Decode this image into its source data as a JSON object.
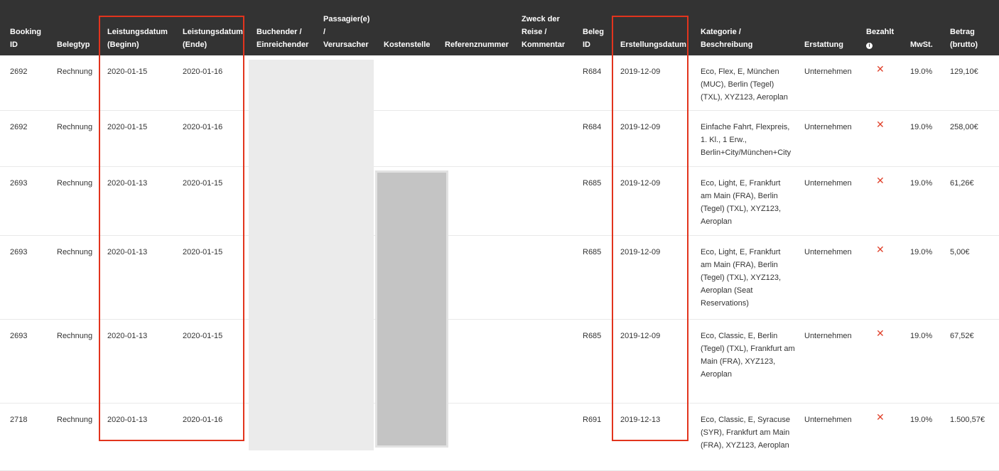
{
  "columns": [
    {
      "key": "booking_id",
      "label": "Booking\nID"
    },
    {
      "key": "belegtyp",
      "label": "Belegtyp"
    },
    {
      "key": "leist_beginn",
      "label": "Leistungsdatum\n(Beginn)"
    },
    {
      "key": "leist_ende",
      "label": "Leistungsdatum\n(Ende)"
    },
    {
      "key": "buchender",
      "label": "Buchender /\nEinreichender"
    },
    {
      "key": "passagier",
      "label": "Passagier(e)\n/\nVerursacher"
    },
    {
      "key": "kostenstelle",
      "label": "Kostenstelle"
    },
    {
      "key": "referenz",
      "label": "Referenznummer"
    },
    {
      "key": "zweck",
      "label": "Zweck der\nReise /\nKommentar"
    },
    {
      "key": "beleg_id",
      "label": "Beleg\nID"
    },
    {
      "key": "erstellung",
      "label": "Erstellungsdatum"
    },
    {
      "key": "kategorie",
      "label": "Kategorie /\nBeschreibung"
    },
    {
      "key": "erstattung",
      "label": "Erstattung"
    },
    {
      "key": "bezahlt",
      "label": "Bezahlt",
      "icon": "info-circle-icon"
    },
    {
      "key": "mwst",
      "label": "MwSt."
    },
    {
      "key": "betrag",
      "label": "Betrag\n(brutto)"
    }
  ],
  "rows": [
    {
      "booking_id": "2692",
      "belegtyp": "Rechnung",
      "leist_beginn": "2020-01-15",
      "leist_ende": "2020-01-16",
      "beleg_id": "R684",
      "erstellung": "2019-12-09",
      "kategorie": "Eco, Flex, E, München\n(MUC), Berlin (Tegel)\n(TXL), XYZ123, Aeroplan",
      "erstattung": "Unternehmen",
      "bezahlt": "✕",
      "mwst": "19.0%",
      "betrag": "129,10€"
    },
    {
      "booking_id": "2692",
      "belegtyp": "Rechnung",
      "leist_beginn": "2020-01-15",
      "leist_ende": "2020-01-16",
      "beleg_id": "R684",
      "erstellung": "2019-12-09",
      "kategorie": "Einfache Fahrt, Flexpreis,\n1. Kl., 1 Erw.,\nBerlin+City/München+City",
      "erstattung": "Unternehmen",
      "bezahlt": "✕",
      "mwst": "19.0%",
      "betrag": "258,00€"
    },
    {
      "booking_id": "2693",
      "belegtyp": "Rechnung",
      "leist_beginn": "2020-01-13",
      "leist_ende": "2020-01-15",
      "beleg_id": "R685",
      "erstellung": "2019-12-09",
      "kategorie": "Eco, Light, E, Frankfurt\nam Main (FRA), Berlin\n(Tegel) (TXL), XYZ123,\nAeroplan",
      "erstattung": "Unternehmen",
      "bezahlt": "✕",
      "mwst": "19.0%",
      "betrag": "61,26€"
    },
    {
      "booking_id": "2693",
      "belegtyp": "Rechnung",
      "leist_beginn": "2020-01-13",
      "leist_ende": "2020-01-15",
      "beleg_id": "R685",
      "erstellung": "2019-12-09",
      "kategorie": "Eco, Light, E, Frankfurt\nam Main (FRA), Berlin\n(Tegel) (TXL), XYZ123,\nAeroplan (Seat\nReservations)",
      "erstattung": "Unternehmen",
      "bezahlt": "✕",
      "mwst": "19.0%",
      "betrag": "5,00€"
    },
    {
      "booking_id": "2693",
      "belegtyp": "Rechnung",
      "leist_beginn": "2020-01-13",
      "leist_ende": "2020-01-15",
      "beleg_id": "R685",
      "erstellung": "2019-12-09",
      "kategorie": "Eco, Classic, E, Berlin\n(Tegel) (TXL), Frankfurt am\nMain (FRA), XYZ123,\nAeroplan",
      "erstattung": "Unternehmen",
      "bezahlt": "✕",
      "mwst": "19.0%",
      "betrag": "67,52€"
    },
    {
      "booking_id": "2718",
      "belegtyp": "Rechnung",
      "leist_beginn": "2020-01-13",
      "leist_ende": "2020-01-16",
      "beleg_id": "R691",
      "erstellung": "2019-12-13",
      "kategorie": "Eco, Classic, E, Syracuse\n(SYR), Frankfurt am Main\n(FRA), XYZ123, Aeroplan",
      "erstattung": "Unternehmen",
      "bezahlt": "✕",
      "mwst": "19.0%",
      "betrag": "1.500,57€"
    }
  ],
  "colors": {
    "header_bg": "#333333",
    "highlight": "#e2341d",
    "not_paid": "#e0412b"
  }
}
